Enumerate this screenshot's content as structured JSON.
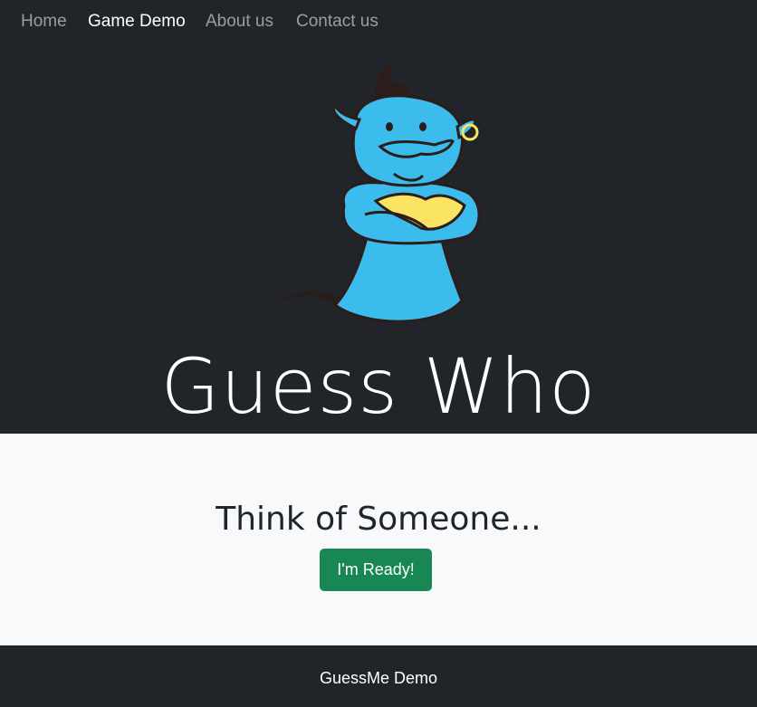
{
  "nav": {
    "items": [
      {
        "label": "Home",
        "active": false
      },
      {
        "label": "Game Demo",
        "active": true
      },
      {
        "label": "About us",
        "active": false
      },
      {
        "label": "Contact us",
        "active": false
      }
    ]
  },
  "hero": {
    "mascot_icon": "genie-mascot-icon",
    "title": "Guess Who"
  },
  "main": {
    "prompt": "Think of Someone...",
    "ready_button": "I'm Ready!"
  },
  "footer": {
    "text": "GuessMe Demo"
  },
  "colors": {
    "dark": "#212529",
    "light": "#f8f9fa",
    "success": "#198754",
    "mascot_blue": "#3bbcec",
    "mascot_yellow": "#fbe463"
  }
}
